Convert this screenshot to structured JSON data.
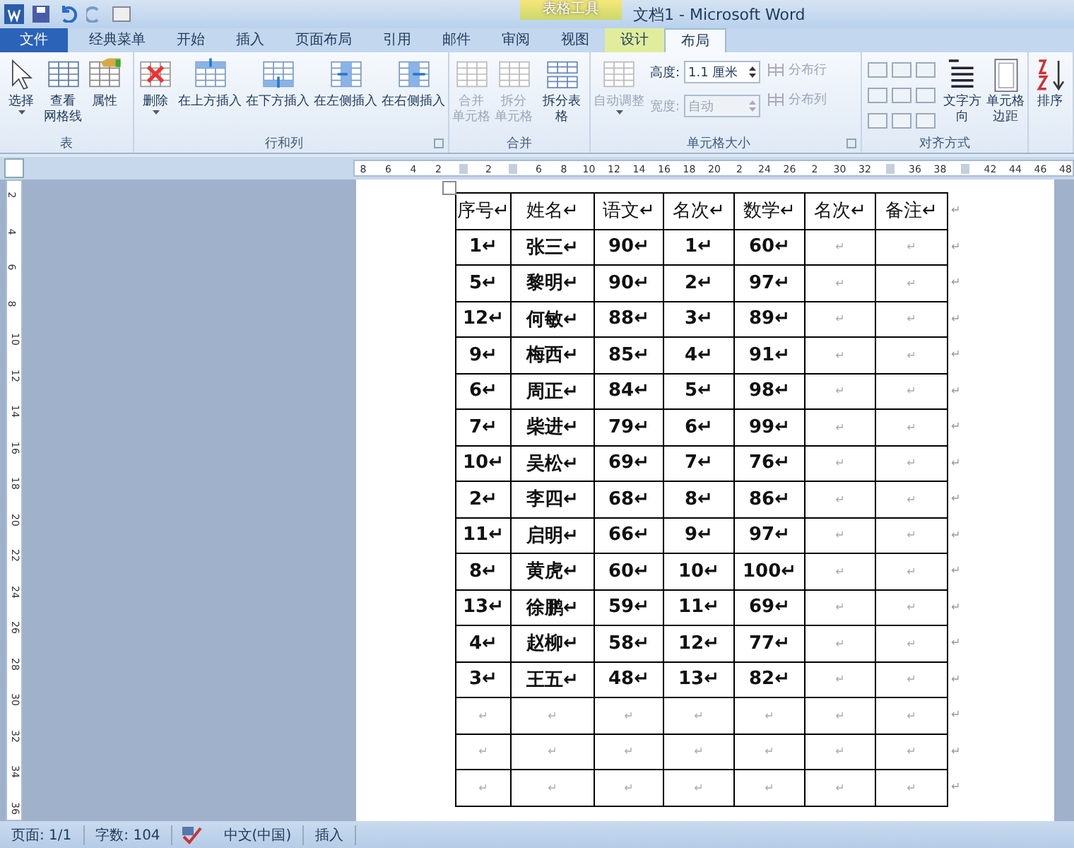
{
  "window": {
    "title": "文档1 - Microsoft Word",
    "context_tab": "表格工具"
  },
  "tabs": [
    {
      "label": "文件",
      "kind": "file",
      "selected": false
    },
    {
      "label": "经典菜单",
      "kind": "tab",
      "selected": false
    },
    {
      "label": "开始",
      "kind": "tab",
      "selected": false
    },
    {
      "label": "插入",
      "kind": "tab",
      "selected": false
    },
    {
      "label": "页面布局",
      "kind": "tab",
      "selected": false
    },
    {
      "label": "引用",
      "kind": "tab",
      "selected": false
    },
    {
      "label": "邮件",
      "kind": "tab",
      "selected": false
    },
    {
      "label": "审阅",
      "kind": "tab",
      "selected": false
    },
    {
      "label": "视图",
      "kind": "tab",
      "selected": false
    },
    {
      "label": "设计",
      "kind": "context",
      "selected": false
    },
    {
      "label": "布局",
      "kind": "context",
      "selected": true
    }
  ],
  "ribbon": {
    "groups": [
      {
        "label": "表",
        "items": [
          {
            "kind": "big",
            "label": "选择",
            "dropdown": true,
            "disabled": false
          },
          {
            "kind": "big",
            "label_lines": [
              "查看",
              "网格线"
            ],
            "dropdown": false,
            "disabled": false
          },
          {
            "kind": "big",
            "label": "属性",
            "dropdown": false,
            "disabled": false
          }
        ]
      },
      {
        "label": "行和列",
        "launcher": true,
        "items": [
          {
            "kind": "big",
            "label": "删除",
            "dropdown": true,
            "disabled": false
          },
          {
            "kind": "big",
            "label": "在上方插入",
            "dropdown": false,
            "disabled": false
          },
          {
            "kind": "big",
            "label": "在下方插入",
            "dropdown": false,
            "disabled": false
          },
          {
            "kind": "big",
            "label": "在左侧插入",
            "dropdown": false,
            "disabled": false
          },
          {
            "kind": "big",
            "label": "在右侧插入",
            "dropdown": false,
            "disabled": false
          }
        ]
      },
      {
        "label": "合并",
        "items": [
          {
            "kind": "big",
            "label_lines": [
              "合并",
              "单元格"
            ],
            "dropdown": false,
            "disabled": true
          },
          {
            "kind": "big",
            "label_lines": [
              "拆分",
              "单元格"
            ],
            "dropdown": false,
            "disabled": true
          },
          {
            "kind": "big",
            "label": "拆分表格",
            "dropdown": false,
            "disabled": false
          }
        ]
      },
      {
        "label": "单元格大小",
        "launcher": true,
        "items": [
          {
            "kind": "big",
            "label": "自动调整",
            "dropdown": true,
            "disabled": true
          },
          {
            "kind": "spin",
            "label": "高度:",
            "value": "1.1 厘米",
            "disabled": false
          },
          {
            "kind": "spin",
            "label": "宽度:",
            "value": "自动",
            "disabled": true
          },
          {
            "kind": "small",
            "label": "分布行",
            "disabled": true
          },
          {
            "kind": "small",
            "label": "分布列",
            "disabled": true
          }
        ]
      },
      {
        "label": "对齐方式",
        "items": [
          {
            "kind": "align"
          },
          {
            "kind": "big",
            "label": "文字方向",
            "dropdown": false,
            "disabled": false
          },
          {
            "kind": "big",
            "label_lines": [
              "单元格",
              "边距"
            ],
            "dropdown": false,
            "disabled": false
          }
        ]
      },
      {
        "items": [
          {
            "kind": "big",
            "label": "排序",
            "dropdown": false,
            "disabled": false
          }
        ]
      }
    ]
  },
  "ruler": {
    "labels": [
      "8",
      "6",
      "4",
      "2",
      "2",
      "6",
      "8",
      "10",
      "12",
      "14",
      "16",
      "18",
      "20",
      "2",
      "24",
      "26",
      "2",
      "30",
      "32",
      "36",
      "38",
      "42",
      "44",
      "46",
      "48"
    ],
    "vertical_labels": [
      "2",
      "4",
      "6",
      "8",
      "10",
      "12",
      "14",
      "16",
      "18",
      "20",
      "22",
      "24",
      "26",
      "28",
      "30",
      "32",
      "34",
      "36"
    ]
  },
  "table": {
    "end_mark": "↵",
    "rows": [
      [
        "序号↵",
        "姓名↵",
        "语文↵",
        "名次↵",
        "数学↵",
        "名次↵",
        "备注↵"
      ],
      [
        "1↵",
        "张三↵",
        "90↵",
        "1↵",
        "60↵",
        "↵",
        "↵"
      ],
      [
        "5↵",
        "黎明↵",
        "90↵",
        "2↵",
        "97↵",
        "↵",
        "↵"
      ],
      [
        "12↵",
        "何敏↵",
        "88↵",
        "3↵",
        "89↵",
        "↵",
        "↵"
      ],
      [
        "9↵",
        "梅西↵",
        "85↵",
        "4↵",
        "91↵",
        "↵",
        "↵"
      ],
      [
        "6↵",
        "周正↵",
        "84↵",
        "5↵",
        "98↵",
        "↵",
        "↵"
      ],
      [
        "7↵",
        "柴进↵",
        "79↵",
        "6↵",
        "99↵",
        "↵",
        "↵"
      ],
      [
        "10↵",
        "吴松↵",
        "69↵",
        "7↵",
        "76↵",
        "↵",
        "↵"
      ],
      [
        "2↵",
        "李四↵",
        "68↵",
        "8↵",
        "86↵",
        "↵",
        "↵"
      ],
      [
        "11↵",
        "启明↵",
        "66↵",
        "9↵",
        "97↵",
        "↵",
        "↵"
      ],
      [
        "8↵",
        "黄虎↵",
        "60↵",
        "10↵",
        "100↵",
        "↵",
        "↵"
      ],
      [
        "13↵",
        "徐鹏↵",
        "59↵",
        "11↵",
        "69↵",
        "↵",
        "↵"
      ],
      [
        "4↵",
        "赵柳↵",
        "58↵",
        "12↵",
        "77↵",
        "↵",
        "↵"
      ],
      [
        "3↵",
        "王五↵",
        "48↵",
        "13↵",
        "82↵",
        "↵",
        "↵"
      ],
      [
        "↵",
        "↵",
        "↵",
        "↵",
        "↵",
        "↵",
        "↵"
      ],
      [
        "↵",
        "↵",
        "↵",
        "↵",
        "↵",
        "↵",
        "↵"
      ],
      [
        "↵",
        "↵",
        "↵",
        "↵",
        "↵",
        "↵",
        "↵"
      ]
    ]
  },
  "status_bar": {
    "items": [
      "页面: 1/1",
      "字数: 104",
      "中文(中国)",
      "插入"
    ]
  }
}
